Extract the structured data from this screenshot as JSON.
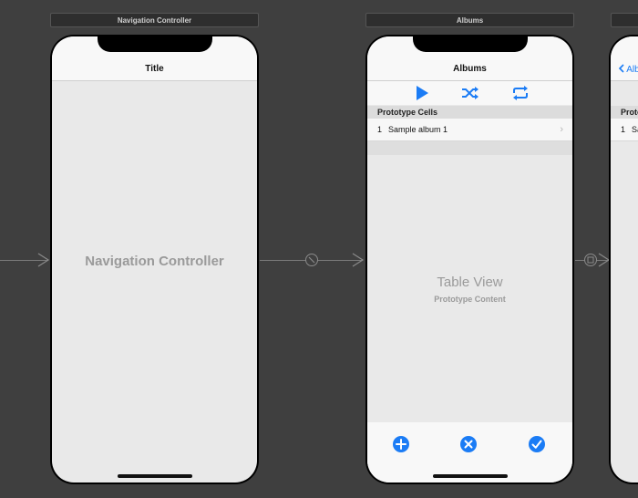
{
  "scenes": [
    {
      "label": "Navigation Controller",
      "nav_title": "Title",
      "center_label": "Navigation Controller"
    },
    {
      "label": "Albums",
      "nav_title": "Albums",
      "toolbar_icons": [
        "play-icon",
        "shuffle-icon",
        "repeat-icon"
      ],
      "section_header": "Prototype Cells",
      "cell": {
        "index": "1",
        "title": "Sample album 1",
        "accessory": "›"
      },
      "center_label": "Table View",
      "center_sublabel": "Prototype Content",
      "bottom_buttons": [
        "add-icon",
        "cancel-icon",
        "checkmark-icon"
      ]
    },
    {
      "label": "",
      "back_label": "Alb",
      "section_header": "Proto",
      "cell": {
        "index": "1",
        "title": "Sa"
      }
    }
  ],
  "colors": {
    "canvas": "#3f3f3f",
    "accent": "#1b7cf5",
    "screen": "#e9e9e9",
    "bar": "#f8f8f8"
  }
}
